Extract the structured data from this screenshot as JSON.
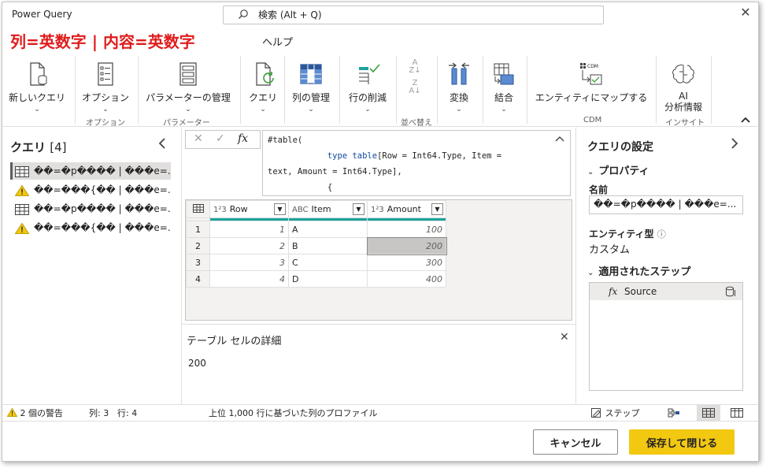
{
  "window": {
    "title": "Power Query",
    "search_placeholder": "検索 (Alt + Q)",
    "close_glyph": "✕"
  },
  "overlay_title": "列=英数字 | 内容=英数字",
  "menu": {
    "help": "ヘルプ"
  },
  "ribbon": {
    "buttons": [
      {
        "label": "新しいクエリ",
        "icon": "new-query-icon"
      },
      {
        "label": "オプション",
        "icon": "options-icon"
      },
      {
        "label": "パラメーターの管理",
        "icon": "manage-parameters-icon"
      },
      {
        "label": "クエリ",
        "icon": "query-refresh-icon"
      },
      {
        "label": "列の管理",
        "icon": "manage-columns-icon"
      },
      {
        "label": "行の削減",
        "icon": "reduce-rows-icon"
      },
      {
        "label": "変換",
        "icon": "transform-icon"
      },
      {
        "label": "結合",
        "icon": "combine-icon"
      },
      {
        "label": "エンティティにマップする",
        "icon": "map-to-entity-icon"
      },
      {
        "label": "AI\n分析情報",
        "icon": "ai-insights-icon"
      }
    ],
    "groups": {
      "options": "オプション",
      "parameters": "パラメーター",
      "sort": "並べ替え",
      "cdm": "CDM",
      "insights": "インサイト"
    },
    "cdm_badge": "CDM"
  },
  "queries": {
    "title": "クエリ",
    "count": "[4]",
    "items": [
      {
        "name": "��=�p���� | ���e=...",
        "type": "table"
      },
      {
        "name": "��=���{�� | ���e=...",
        "type": "warning"
      },
      {
        "name": "��=�p���� | ���e=...",
        "type": "table"
      },
      {
        "name": "��=���{�� | ���e=...",
        "type": "warning"
      }
    ]
  },
  "formula": {
    "line1": "#table(",
    "line2_kw": "type table",
    "line2": "[Row = Int64.Type, Item =",
    "line3": "text, Amount = Int64.Type],",
    "line4": "{",
    "fx": "fx"
  },
  "grid": {
    "columns": [
      {
        "name": "Row",
        "type_icon": "1²3"
      },
      {
        "name": "Item",
        "type_icon": "ABC"
      },
      {
        "name": "Amount",
        "type_icon": "1²3"
      }
    ],
    "rows": [
      {
        "n": "1",
        "row": "1",
        "item": "A",
        "amount": "100"
      },
      {
        "n": "2",
        "row": "2",
        "item": "B",
        "amount": "200"
      },
      {
        "n": "3",
        "row": "3",
        "item": "C",
        "amount": "300"
      },
      {
        "n": "4",
        "row": "4",
        "item": "D",
        "amount": "400"
      }
    ]
  },
  "detail": {
    "title": "テーブル セルの詳細",
    "value": "200"
  },
  "settings": {
    "title": "クエリの設定",
    "properties": "プロパティ",
    "name_label": "名前",
    "name_value": "��=�p���� | ���e=...",
    "entity_label": "エンティティ型",
    "entity_value": "カスタム",
    "steps_title": "適用されたステップ",
    "steps": [
      {
        "label": "Source"
      }
    ]
  },
  "status": {
    "warnings": "2 個の警告",
    "columns": "列: 3",
    "rows": "行: 4",
    "profile": "上位 1,000 行に基づいた列のプロファイル",
    "step": "ステップ"
  },
  "footer": {
    "cancel": "キャンセル",
    "save": "保存して閉じる"
  },
  "colors": {
    "accent_yellow": "#f2c811",
    "quality_bar": "#1ca39d",
    "overlay_red": "#e01b1b"
  }
}
